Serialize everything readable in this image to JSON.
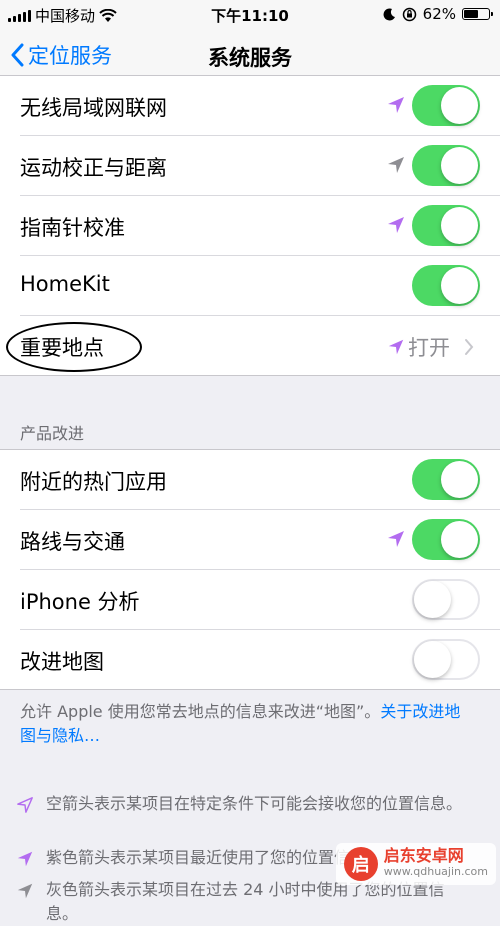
{
  "status_bar": {
    "carrier": "中国移动",
    "time": "下午11:10",
    "battery": "62%",
    "battery_fraction": 0.62
  },
  "nav": {
    "back_label": "定位服务",
    "title": "系统服务"
  },
  "system_items": [
    {
      "label": "无线局域网联网",
      "toggle": true,
      "arrow": "purple"
    },
    {
      "label": "运动校正与距离",
      "toggle": true,
      "arrow": "gray"
    },
    {
      "label": "指南针校准",
      "toggle": true,
      "arrow": "purple"
    },
    {
      "label": "HomeKit",
      "toggle": true,
      "arrow": ""
    },
    {
      "label": "重要地点",
      "value": "打开",
      "arrow": "purple-outline"
    }
  ],
  "section_header": "产品改进",
  "improve_items": [
    {
      "label": "附近的热门应用",
      "toggle": true
    },
    {
      "label": "路线与交通",
      "toggle": true
    },
    {
      "label": "iPhone 分析",
      "toggle": false
    },
    {
      "label": "改进地图",
      "toggle": false
    }
  ],
  "footer": {
    "text": "允许 Apple 使用您常去地点的信息来改进“地图”。",
    "link": "关于改进地图与隐私…"
  },
  "legend": [
    {
      "text": "空箭头表示某项目在特定条件下可能会接收您的位置信息。"
    },
    {
      "text": "紫色箭头表示某项目最近使用了您的位置信息。"
    },
    {
      "text": "灰色箭头表示某项目在过去 24 小时中使用了您的位置信息。"
    }
  ],
  "watermark": {
    "logo_text": "启",
    "name": "启东安卓网",
    "url": "www.qdhuajin.com"
  },
  "colors": {
    "accent": "#007aff",
    "toggle_on": "#4cd964",
    "arrow_purple": "#b36cf0",
    "arrow_gray": "#8e8e93"
  }
}
